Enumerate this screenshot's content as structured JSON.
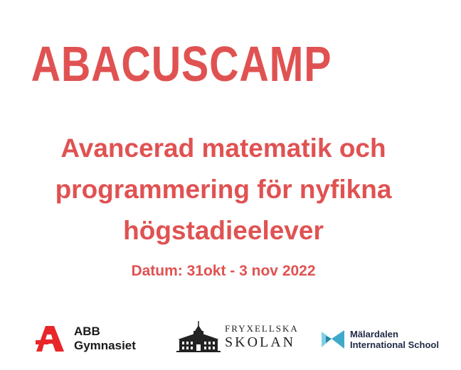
{
  "title": "ABACUSCAMP",
  "subtitle": {
    "line1": "Avancerad matematik och",
    "line2": "programmering för nyfikna",
    "line3": "högstadieelever"
  },
  "date": "Datum: 31okt - 3 nov 2022",
  "logos": {
    "abb": {
      "line1": "ABB",
      "line2": "Gymnasiet"
    },
    "fryxellska": {
      "line1": "FRYXELLSKA",
      "line2": "SKOLAN"
    },
    "malardalen": {
      "line1": "Mälardalen",
      "line2": "International School"
    }
  },
  "colors": {
    "accent": "#e05252",
    "abb_red": "#e8262a",
    "mis_teal": "#3fa9c9"
  }
}
